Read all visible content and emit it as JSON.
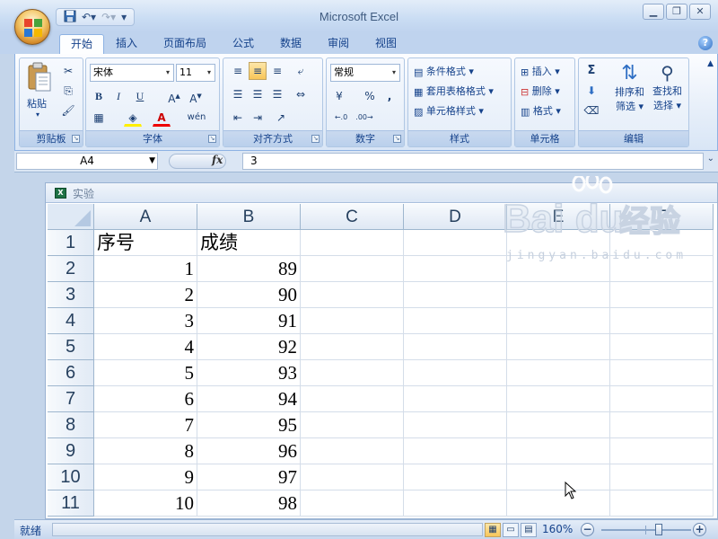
{
  "app": {
    "title": "Microsoft Excel",
    "qat_icons": [
      "save-icon",
      "undo-icon",
      "redo-icon",
      "customize-icon"
    ]
  },
  "tabs": [
    "开始",
    "插入",
    "页面布局",
    "公式",
    "数据",
    "审阅",
    "视图"
  ],
  "ribbon": {
    "clipboard": {
      "label": "剪贴板",
      "paste": "粘贴"
    },
    "font": {
      "label": "字体",
      "font_name": "宋体",
      "font_size": "11",
      "bold": "B",
      "italic": "I",
      "underline": "U",
      "phonetic": "wén"
    },
    "alignment": {
      "label": "对齐方式"
    },
    "number": {
      "label": "数字",
      "format": "常规",
      "percent": "%",
      "comma": ","
    },
    "styles": {
      "label": "样式",
      "conditional": "条件格式",
      "table": "套用表格格式",
      "cell_styles": "单元格样式"
    },
    "cells": {
      "label": "单元格",
      "insert": "插入",
      "delete": "删除",
      "format": "格式"
    },
    "editing": {
      "label": "编辑",
      "sort": "排序和",
      "sort2": "筛选",
      "find": "查找和",
      "find2": "选择",
      "sum": "Σ"
    }
  },
  "formula_bar": {
    "name_box": "A4",
    "fx": "fx",
    "value": "3"
  },
  "workbook": {
    "title": "实验",
    "columns": [
      "A",
      "B",
      "C",
      "D",
      "E",
      "F"
    ],
    "rows": [
      {
        "num": "1",
        "a": "序号",
        "b": "成绩"
      },
      {
        "num": "2",
        "a": "1",
        "b": "89"
      },
      {
        "num": "3",
        "a": "2",
        "b": "90"
      },
      {
        "num": "4",
        "a": "3",
        "b": "91"
      },
      {
        "num": "5",
        "a": "4",
        "b": "92"
      },
      {
        "num": "6",
        "a": "5",
        "b": "93"
      },
      {
        "num": "7",
        "a": "6",
        "b": "94"
      },
      {
        "num": "8",
        "a": "7",
        "b": "95"
      },
      {
        "num": "9",
        "a": "8",
        "b": "96"
      },
      {
        "num": "10",
        "a": "9",
        "b": "97"
      },
      {
        "num": "11",
        "a": "10",
        "b": "98"
      }
    ]
  },
  "watermark": {
    "text": "Baidu经验",
    "sub": "jingyan.baidu.com"
  },
  "status": {
    "ready": "就绪",
    "zoom": "160%"
  }
}
